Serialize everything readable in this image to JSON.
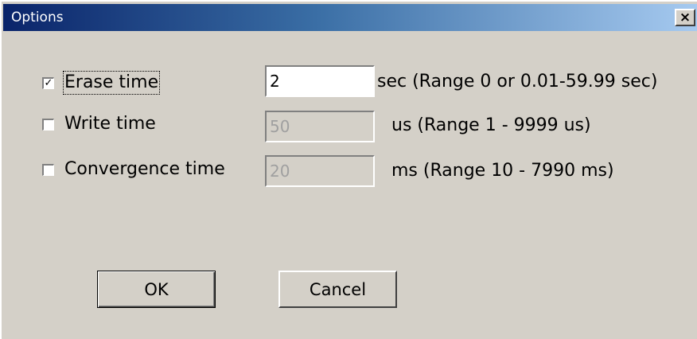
{
  "window": {
    "title": "Options",
    "close_label": "×"
  },
  "options": [
    {
      "label": "Erase time",
      "checked": true,
      "check_mark": "✓",
      "value": "2",
      "enabled": true,
      "range_text": "sec (Range 0 or 0.01-59.99 sec)"
    },
    {
      "label": "Write time",
      "checked": false,
      "check_mark": "",
      "value": "50",
      "enabled": false,
      "range_text": "us (Range 1 - 9999 us)"
    },
    {
      "label": "Convergence time",
      "checked": false,
      "check_mark": "",
      "value": "20",
      "enabled": false,
      "range_text": "ms (Range 10 - 7990 ms)"
    }
  ],
  "buttons": {
    "ok_label": "OK",
    "cancel_label": "Cancel"
  },
  "colors": {
    "face": "#d4d0c8",
    "title_start": "#0a246a",
    "title_end": "#a6caf0",
    "disabled_text": "#a0a0a0"
  },
  "icons": {
    "checkbox": "checkbox-icon",
    "close": "close-icon"
  }
}
